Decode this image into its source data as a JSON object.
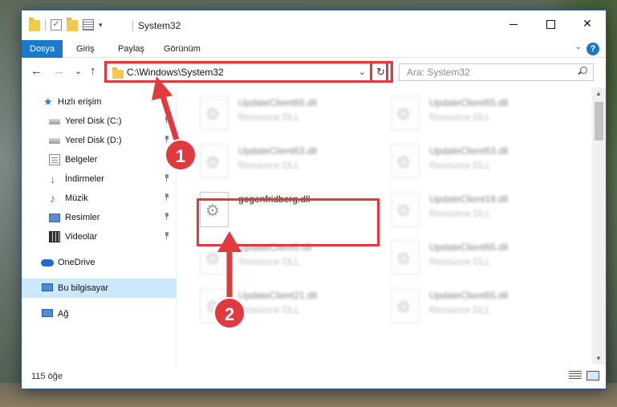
{
  "window": {
    "title": "System32",
    "quick_access_icons": [
      "folder-icon",
      "checkbox-icon",
      "properties-icon",
      "folder-icon",
      "customize-dropdown-icon"
    ]
  },
  "window_controls": {
    "minimize": "minimize",
    "maximize": "maximize",
    "close": "✕"
  },
  "ribbon": {
    "tabs": [
      {
        "label": "Dosya",
        "active": true
      },
      {
        "label": "Giriş",
        "active": false
      },
      {
        "label": "Paylaş",
        "active": false
      },
      {
        "label": "Görünüm",
        "active": false
      }
    ],
    "help": "?",
    "collapse": "⌄"
  },
  "navigation": {
    "back": "←",
    "forward": "→",
    "recent": "⌄",
    "up": "↑"
  },
  "address_bar": {
    "path": "C:\\Windows\\System32",
    "dropdown": "⌄",
    "refresh": "↻"
  },
  "search": {
    "placeholder": "Ara: System32"
  },
  "sidebar": {
    "items": [
      {
        "label": "Hızlı erişim",
        "icon": "star-icon",
        "pinned": false,
        "selected": false
      },
      {
        "label": "Yerel Disk (C:)",
        "icon": "disk-icon",
        "pinned": true,
        "selected": false
      },
      {
        "label": "Yerel Disk (D:)",
        "icon": "disk-icon",
        "pinned": true,
        "selected": false
      },
      {
        "label": "Belgeler",
        "icon": "documents-icon",
        "pinned": true,
        "selected": false
      },
      {
        "label": "İndirmeler",
        "icon": "download-icon",
        "pinned": true,
        "selected": false
      },
      {
        "label": "Müzik",
        "icon": "music-icon",
        "pinned": true,
        "selected": false
      },
      {
        "label": "Resimler",
        "icon": "pictures-icon",
        "pinned": true,
        "selected": false
      },
      {
        "label": "Videolar",
        "icon": "videos-icon",
        "pinned": true,
        "selected": false
      },
      {
        "label": "OneDrive",
        "icon": "cloud-icon",
        "pinned": false,
        "selected": false
      },
      {
        "label": "Bu bilgisayar",
        "icon": "computer-icon",
        "pinned": false,
        "selected": true
      },
      {
        "label": "Ağ",
        "icon": "network-icon",
        "pinned": false,
        "selected": false
      }
    ]
  },
  "files": [
    {
      "name": "UpdateClient65.dll",
      "type": "Resource DLL",
      "blurred": true
    },
    {
      "name": "UpdateClient65.dll",
      "type": "Resource DLL",
      "blurred": true
    },
    {
      "name": "UpdateClient63.dll",
      "type": "Resource DLL",
      "blurred": true
    },
    {
      "name": "UpdateClient63.dll",
      "type": "Resource DLL",
      "blurred": true
    },
    {
      "name": "gogenfridberg.dll",
      "type": "",
      "blurred": false
    },
    {
      "name": "UpdateClient19.dll",
      "type": "Resource DLL",
      "blurred": true
    },
    {
      "name": "UpdateClient5.dll",
      "type": "Resource DLL",
      "blurred": true
    },
    {
      "name": "UpdateClient65.dll",
      "type": "Resource DLL",
      "blurred": true
    },
    {
      "name": "UpdateClient21.dll",
      "type": "Resource DLL",
      "blurred": true
    },
    {
      "name": "UpdateClient65.dll",
      "type": "Resource DLL",
      "blurred": true
    }
  ],
  "status": {
    "item_count": "115 öğe"
  },
  "annotations": {
    "step1": "1",
    "step2": "2",
    "color": "#e0393e"
  },
  "colors": {
    "accent": "#1979ca",
    "selection": "#cce8ff",
    "annotation_red": "#e0393e"
  }
}
